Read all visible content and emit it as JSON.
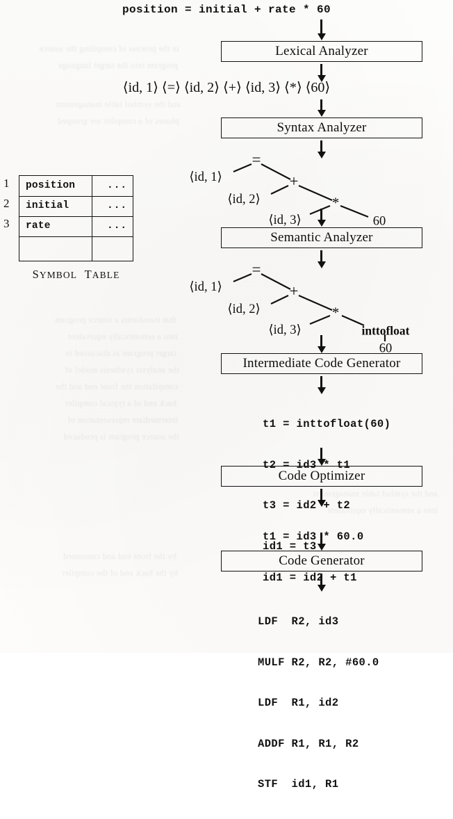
{
  "figure": {
    "source_line": "position = initial + rate * 60",
    "tokens_line": "⟨id, 1⟩ ⟨=⟩ ⟨id, 2⟩ ⟨+⟩ ⟨id, 3⟩ ⟨*⟩ ⟨60⟩",
    "phases": [
      {
        "name": "lexical-analyzer",
        "label": "Lexical Analyzer"
      },
      {
        "name": "syntax-analyzer",
        "label": "Syntax Analyzer"
      },
      {
        "name": "semantic-analyzer",
        "label": "Semantic Analyzer"
      },
      {
        "name": "intermediate-code-generator",
        "label": "Intermediate Code Generator"
      },
      {
        "name": "code-optimizer",
        "label": "Code Optimizer"
      },
      {
        "name": "code-generator",
        "label": "Code Generator"
      }
    ],
    "intermediate_code": [
      "t1 = inttofloat(60)",
      "t2 = id3 * t1",
      "t3 = id2 + t2",
      "id1 = t3"
    ],
    "optimized_code": [
      "t1 = id3 * 60.0",
      "id1 = id2 + t1"
    ],
    "target_code": [
      "LDF  R2, id3",
      "MULF R2, R2, #60.0",
      "LDF  R1, id2",
      "ADDF R1, R1, R2",
      "STF  id1, R1"
    ],
    "syntax_tree": {
      "root": "=",
      "nodes": [
        {
          "id": "eq",
          "label": "=",
          "kind": "op"
        },
        {
          "id": "id1",
          "label": "⟨id, 1⟩",
          "kind": "token"
        },
        {
          "id": "plus",
          "label": "+",
          "kind": "op"
        },
        {
          "id": "id2",
          "label": "⟨id, 2⟩",
          "kind": "token"
        },
        {
          "id": "star",
          "label": "*",
          "kind": "op"
        },
        {
          "id": "id3",
          "label": "⟨id, 3⟩",
          "kind": "token"
        },
        {
          "id": "num",
          "label": "60",
          "kind": "number"
        }
      ]
    },
    "semantic_tree": {
      "root": "=",
      "nodes": [
        {
          "id": "eq",
          "label": "=",
          "kind": "op"
        },
        {
          "id": "id1",
          "label": "⟨id, 1⟩",
          "kind": "token"
        },
        {
          "id": "plus",
          "label": "+",
          "kind": "op"
        },
        {
          "id": "id2",
          "label": "⟨id, 2⟩",
          "kind": "token"
        },
        {
          "id": "star",
          "label": "*",
          "kind": "op"
        },
        {
          "id": "id3",
          "label": "⟨id, 3⟩",
          "kind": "token"
        },
        {
          "id": "conv",
          "label": "inttofloat",
          "kind": "conversion"
        },
        {
          "id": "num",
          "label": "60",
          "kind": "number"
        }
      ]
    }
  },
  "symbol_table": {
    "caption": "Symbol Table",
    "caption_first": "S",
    "caption_rest": "YMBOL",
    "caption_second_first": "T",
    "caption_second_rest": "ABLE",
    "rows": [
      {
        "index": "1",
        "name": "position",
        "attributes": "..."
      },
      {
        "index": "2",
        "name": "initial",
        "attributes": "..."
      },
      {
        "index": "3",
        "name": "rate",
        "attributes": "..."
      },
      {
        "index": "",
        "name": "",
        "attributes": ""
      }
    ]
  },
  "ghost_text": {
    "lines": [
      "in the process of compiling the source",
      "program into the target language",
      "and the symbol table management",
      "phases of a compiler are grouped",
      "that transforms a source program",
      "into a semantically equivalent",
      "target program as discussed in",
      "the analysis synthesis model of",
      "compilation the front end and the",
      "back end of a typical compiler",
      "intermediate representation of",
      "the source program is produced",
      "by the front end and consumed",
      "by the back end of the compiler"
    ]
  },
  "colors": {
    "ink": "#111111",
    "paper": "#fdfcfa",
    "ghost": "rgba(60,55,50,0.085)"
  }
}
